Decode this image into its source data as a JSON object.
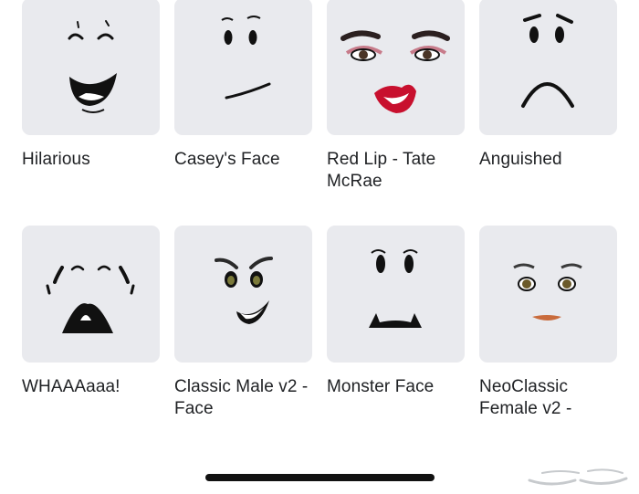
{
  "items": [
    {
      "name": "Hilarious",
      "icon": "hilarious-face-icon"
    },
    {
      "name": "Casey's Face",
      "icon": "casey-face-icon"
    },
    {
      "name": "Red Lip - Tate McRae",
      "icon": "red-lip-face-icon"
    },
    {
      "name": "Anguished",
      "icon": "anguished-face-icon"
    },
    {
      "name": "WHAAAaaa!",
      "icon": "whaaaaaa-face-icon"
    },
    {
      "name": "Classic Male v2 - Face",
      "icon": "classic-male-face-icon"
    },
    {
      "name": "Monster Face",
      "icon": "monster-face-icon"
    },
    {
      "name": "NeoClassic Female v2 -",
      "icon": "neoclassic-female-face-icon"
    }
  ],
  "watermark": {
    "text": "حراج",
    "icon": "haraj-logo-icon"
  },
  "colors": {
    "thumb_bg": "#e9eaee",
    "label": "#202225",
    "lip_red": "#c8102e"
  }
}
